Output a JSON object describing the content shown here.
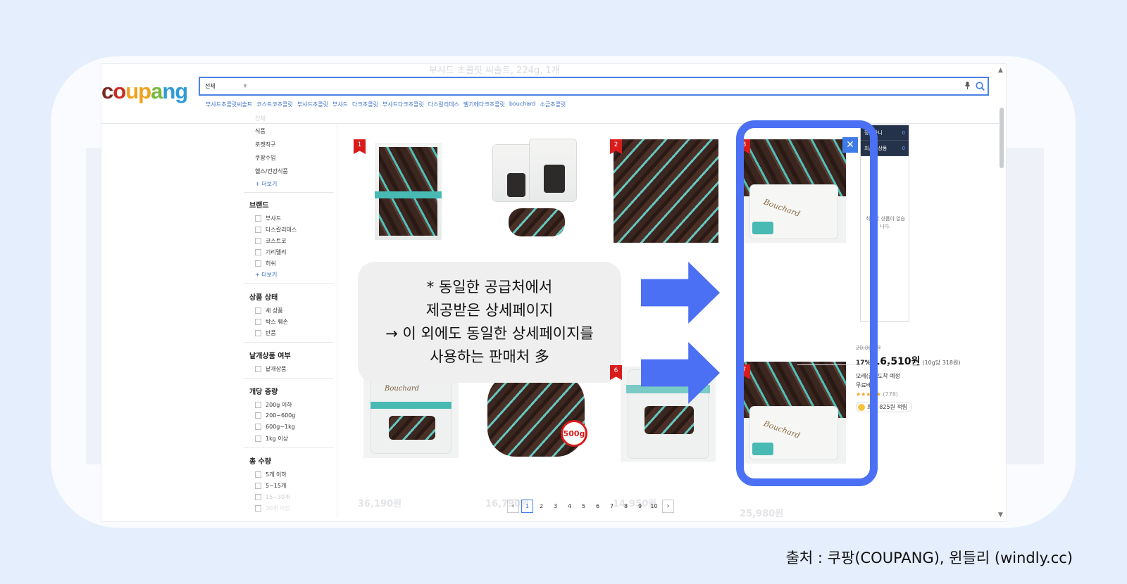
{
  "ghost_title": "부샤드 초콜릿 씨솔트, 224g, 1개",
  "logo": {
    "parts": [
      "c",
      "o",
      "u",
      "p",
      "a",
      "n",
      "g"
    ]
  },
  "search": {
    "category": "전체",
    "value": ""
  },
  "related_keywords": [
    "부샤드초콜릿씨솔트",
    "코스트코초콜릿",
    "부샤드초콜릿",
    "부샤드",
    "다크초콜릿",
    "부샤드다크초콜릿",
    "다스칼리데스",
    "벨기에다크초콜릿",
    "bouchard",
    "소금초콜릿"
  ],
  "sidebar": {
    "faded_top": "전체",
    "categories": [
      "식품",
      "로켓직구",
      "쿠팡수입",
      "헬스/건강식품"
    ],
    "more_label": "+ 더보기",
    "brand": {
      "title": "브랜드",
      "options": [
        "부샤드",
        "다스칼리데스",
        "코스트코",
        "기리델리",
        "허쉬"
      ],
      "more": "+ 더보기"
    },
    "condition": {
      "title": "상품 상태",
      "options": [
        "새 상품",
        "박스 훼손",
        "반품"
      ]
    },
    "single": {
      "title": "낱개상품 여부",
      "options": [
        "낱개상품"
      ]
    },
    "weight": {
      "title": "개당 중량",
      "options": [
        "200g 이하",
        "200~600g",
        "600g~1kg",
        "1kg 이상"
      ]
    },
    "count": {
      "title": "총 수량",
      "options": [
        "5개 이하",
        "5~15개",
        "15~30개",
        "30개 이상"
      ]
    }
  },
  "products": {
    "ranks": [
      "1",
      "2",
      "3",
      "6",
      "7"
    ],
    "badge_500": "500g",
    "brand_print": "Bouchard",
    "highlighted": {
      "original_price": "20,000원",
      "discount": "17%",
      "price": "16,510원",
      "unit_price": "(10g당 318원)",
      "delivery": "모레(금) 도착 예정",
      "shipping": "무료배송",
      "stars": "★★★★★",
      "reviews": "(778)",
      "points": "최대 825원 적립"
    },
    "faded_prices": [
      "36,190원",
      "16,790원",
      "14,950원",
      "25,980원"
    ]
  },
  "recent_panel": {
    "cart_label": "장바구니",
    "cart_count": "0",
    "recent_label": "최근본상품",
    "recent_count": "0",
    "empty_text": "최근본 상품이 없습니다."
  },
  "pagination": {
    "prev": "‹",
    "next": "›",
    "pages": [
      "1",
      "2",
      "3",
      "4",
      "5",
      "6",
      "7",
      "8",
      "9",
      "10"
    ],
    "current": "1"
  },
  "annotation": {
    "lines": [
      "* 동일한 공급처에서",
      "제공받은 상세페이지",
      "→ 이 외에도 동일한 상세페이지를",
      "사용하는 판매처 多"
    ]
  },
  "caption": "출처 : 쿠팡(COUPANG), 윈들리 (windly.cc)",
  "colors": {
    "accent": "#4b70f4",
    "search_border": "#4a83e6",
    "rank_red": "#d81c1c",
    "panel_dark": "#25334a"
  }
}
